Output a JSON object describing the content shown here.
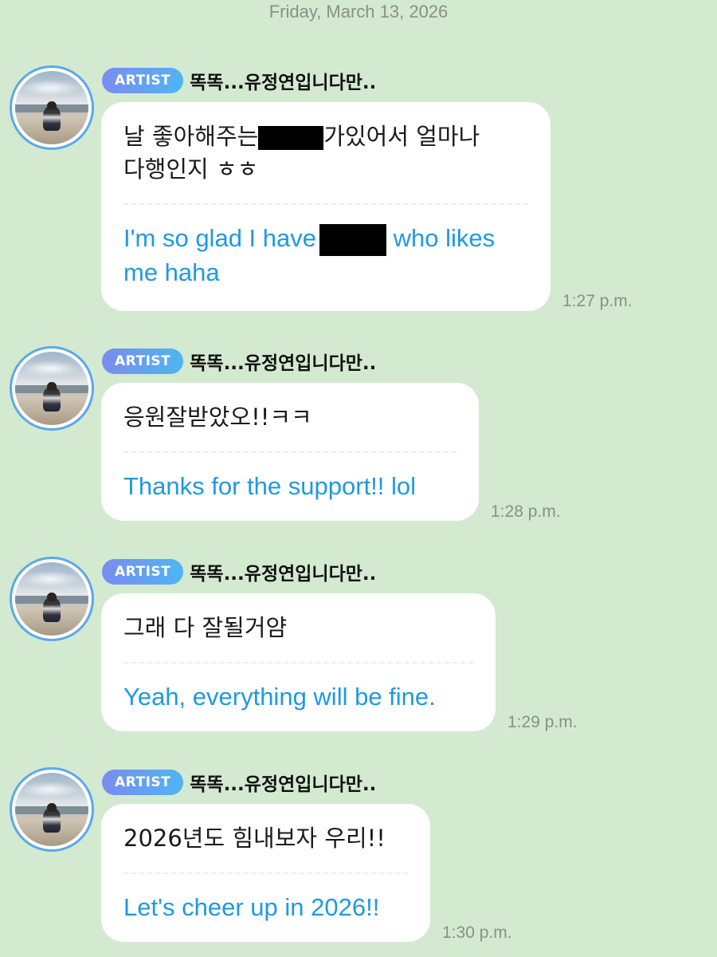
{
  "date_header": "Friday, March 13, 2026",
  "messages": [
    {
      "badge": "ARTIST",
      "sender": "똑똑...유정연입니다만..",
      "korean_before": "날 좋아해주는",
      "korean_after": "가있어서 얼마나",
      "korean_line2": "다행인지 ㅎㅎ",
      "english_before": "I'm so glad I have",
      "english_after": " who likes",
      "english_line2": "me haha",
      "time": "1:27 p.m."
    },
    {
      "badge": "ARTIST",
      "sender": "똑똑...유정연입니다만..",
      "korean": "응원잘받았오!!ㅋㅋ",
      "english": "Thanks for the support!! lol",
      "time": "1:28 p.m."
    },
    {
      "badge": "ARTIST",
      "sender": "똑똑...유정연입니다만..",
      "korean": "그래 다 잘될거얌",
      "english": "Yeah, everything will be fine.",
      "time": "1:29 p.m."
    },
    {
      "badge": "ARTIST",
      "sender": "똑똑...유정연입니다만..",
      "korean": "2026년도 힘내보자 우리!!",
      "english": "Let's cheer up in 2026!!",
      "time": "1:30 p.m."
    }
  ],
  "colors": {
    "background": "#d3ead0",
    "badge_gradient_start": "#7a8cf0",
    "badge_gradient_end": "#4fb5f2",
    "translation_text": "#1e9ae0",
    "bubble": "#ffffff",
    "redaction": "#000000"
  },
  "icons": {
    "avatar": "profile-photo-beach"
  }
}
